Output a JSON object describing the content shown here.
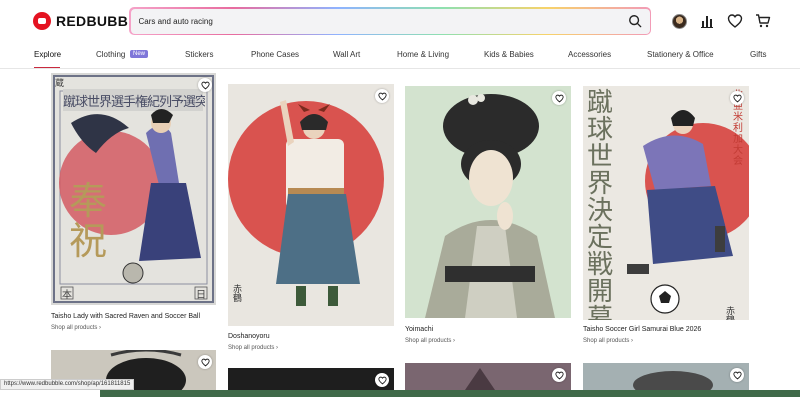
{
  "brand": {
    "name": "REDBUBBLE",
    "color": "#e41321"
  },
  "search": {
    "value": "Cars and auto racing"
  },
  "header_icons": [
    "avatar",
    "bar-chart-icon",
    "heart-icon",
    "cart-icon"
  ],
  "nav": {
    "items": [
      "Explore",
      "Clothing",
      "Stickers",
      "Phone Cases",
      "Wall Art",
      "Home & Living",
      "Kids & Babies",
      "Accessories",
      "Stationery & Office",
      "Gifts"
    ],
    "badge": "New",
    "active": "Explore"
  },
  "cards": [
    {
      "title": "Taisho Lady with Sacred Raven and Soccer Ball",
      "link": "Shop all products ›"
    },
    {
      "title": "Doshanoyoru",
      "link": "Shop all products ›"
    },
    {
      "title": "Yoimachi",
      "link": "Shop all products ›"
    },
    {
      "title": "Taisho Soccer Girl Samurai Blue 2026",
      "link": "Shop all products ›"
    }
  ],
  "artwork_text": {
    "card1_vertical": "奉祝",
    "card1_header": "蹴球世界選手権紀列予選突破記念",
    "card1_corner_left": "本",
    "card1_corner_right": "日",
    "card1_top_left": "蔵",
    "card4_vertical": "蹴球世界決定戦開幕",
    "card4_side": "北亜米利加大会"
  },
  "status_url": "https://www.redbubble.com/shop/ap/161811815"
}
